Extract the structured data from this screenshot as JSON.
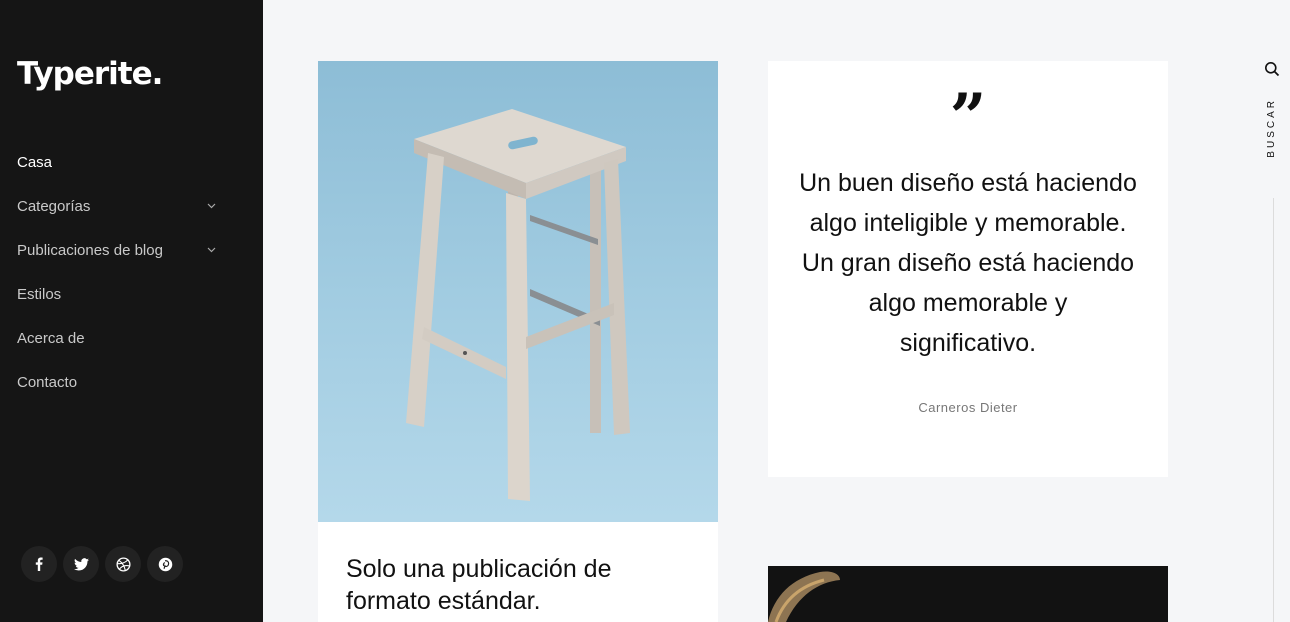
{
  "brand": {
    "logo": "Typerite."
  },
  "nav": {
    "items": [
      {
        "label": "Casa",
        "active": true,
        "has_submenu": false
      },
      {
        "label": "Categorías",
        "active": false,
        "has_submenu": true
      },
      {
        "label": "Publicaciones de blog",
        "active": false,
        "has_submenu": true
      },
      {
        "label": "Estilos",
        "active": false,
        "has_submenu": false
      },
      {
        "label": "Acerca de",
        "active": false,
        "has_submenu": false
      },
      {
        "label": "Contacto",
        "active": false,
        "has_submenu": false
      }
    ]
  },
  "social": [
    "facebook-icon",
    "twitter-icon",
    "dribbble-icon",
    "pinterest-icon"
  ],
  "posts": {
    "standard": {
      "title": "Solo una publicación de formato estándar.",
      "image": "stool-photo"
    },
    "quote": {
      "mark": "”",
      "text": "Un buen diseño está haciendo algo inteligible y memorable. Un gran diseño está haciendo algo memorable y significativo.",
      "author": "Carneros Dieter"
    }
  },
  "search": {
    "label": "BUSCAR",
    "icon": "search-icon"
  },
  "colors": {
    "sidebar_bg": "#151515",
    "page_bg": "#f5f6f8",
    "photo_bg": "#9fcbe0"
  }
}
